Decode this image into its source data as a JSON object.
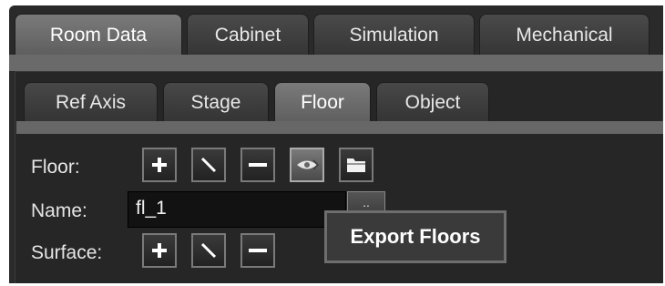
{
  "main_tabs": [
    {
      "label": "Room Data",
      "active": true
    },
    {
      "label": "Cabinet",
      "active": false
    },
    {
      "label": "Simulation",
      "active": false
    },
    {
      "label": "Mechanical",
      "active": false
    }
  ],
  "sub_tabs": [
    {
      "label": "Ref Axis",
      "active": false
    },
    {
      "label": "Stage",
      "active": false
    },
    {
      "label": "Floor",
      "active": true
    },
    {
      "label": "Object",
      "active": false
    }
  ],
  "floor_row": {
    "label": "Floor:",
    "buttons": [
      "plus-icon",
      "edit-pencil-icon",
      "minus-icon",
      "export-eye-icon",
      "folder-icon"
    ]
  },
  "name_row": {
    "label": "Name:",
    "value": "fl_1",
    "extra_button_text": ".."
  },
  "surface_row": {
    "label": "Surface:",
    "buttons": [
      "plus-icon",
      "edit-pencil-icon",
      "minus-icon"
    ]
  },
  "tooltip": {
    "text": "Export Floors"
  }
}
